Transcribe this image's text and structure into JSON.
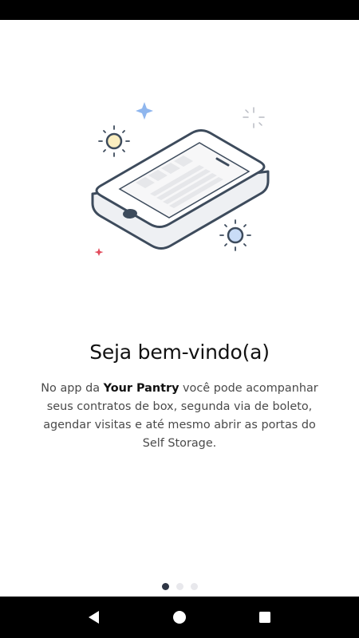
{
  "onboarding": {
    "title": "Seja bem-vindo(a)",
    "description_before": "No app da ",
    "description_brand": "Your Pantry",
    "description_after": " você pode acompanhar seus contratos de box, segunda via de boleto, agendar visitas e até mesmo abrir as portas do Self Storage.",
    "illustration": "phone-illustration",
    "page_indicator": {
      "total": 3,
      "current": 1
    }
  },
  "nav_bar": {
    "back_icon": "back-triangle-icon",
    "home_icon": "home-circle-icon",
    "recents_icon": "recents-square-icon"
  },
  "colors": {
    "text_primary": "#111111",
    "text_secondary": "#4a4a4a",
    "phone_outline": "#3d4b5c",
    "dot_active": "#2f3645",
    "dot_inactive": "#e8e8ec",
    "sparkle_blue": "#8fb6ee",
    "sparkle_red": "#e24b5c",
    "sun_yellow": "#fbeec0",
    "sun_blue": "#c9dcf7"
  }
}
